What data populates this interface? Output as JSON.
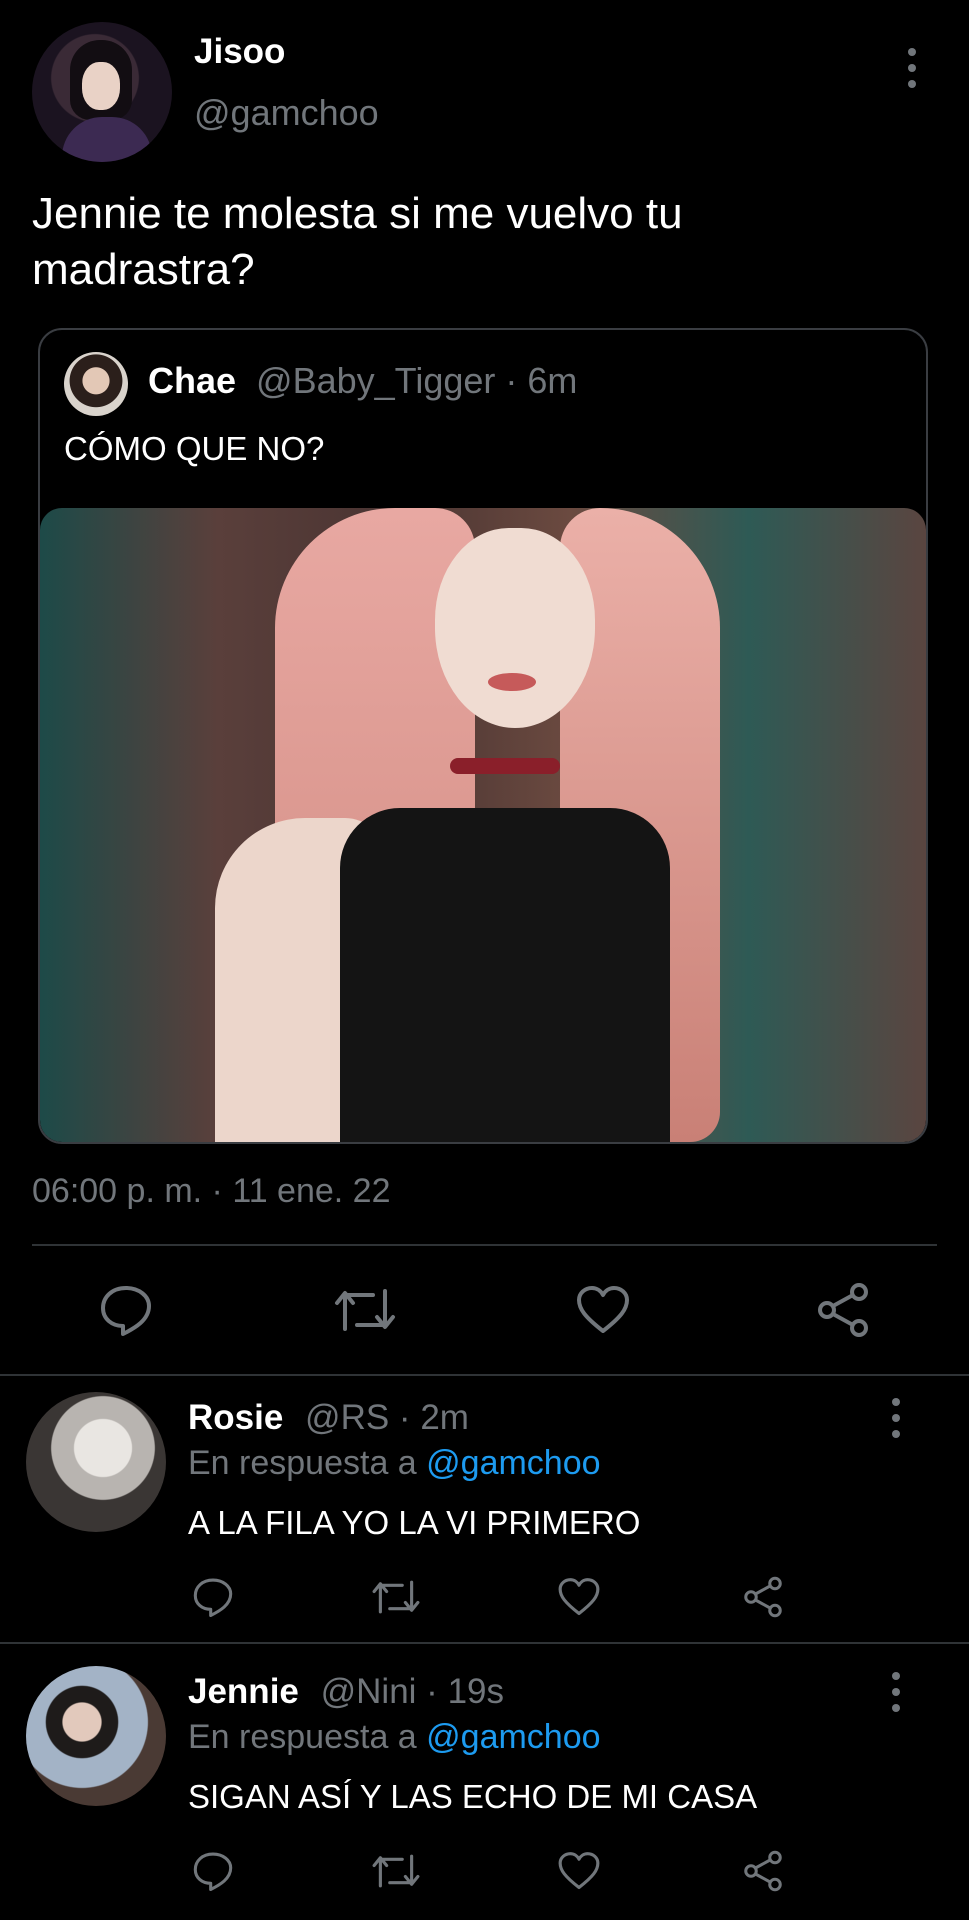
{
  "main_tweet": {
    "author_name": "Jisoo",
    "author_handle": "@gamchoo",
    "text": "Jennie te molesta si me vuelvo tu madrastra?",
    "timestamp": "06:00 p. m. · 11 ene. 22",
    "quoted": {
      "name": "Chae",
      "handle": "@Baby_Tigger",
      "separator": " · ",
      "time": "6m",
      "text": "CÓMO QUE NO?"
    },
    "actions": [
      "reply-icon",
      "retweet-icon",
      "like-icon",
      "share-icon"
    ]
  },
  "replies": [
    {
      "name": "Rosie",
      "handle": "@RS",
      "separator": " · ",
      "time": "2m",
      "in_reply_prefix": "En respuesta a ",
      "in_reply_mention": "@gamchoo",
      "text": "A LA FILA YO LA VI PRIMERO"
    },
    {
      "name": "Jennie",
      "handle": "@Nini",
      "separator": " · ",
      "time": "19s",
      "in_reply_prefix": "En respuesta a ",
      "in_reply_mention": "@gamchoo",
      "text": "SIGAN ASÍ Y LAS ECHO DE MI CASA"
    }
  ],
  "colors": {
    "background": "#000000",
    "text_primary": "#ffffff",
    "text_secondary": "#71767b",
    "link": "#1d9bf0",
    "divider": "#2f3336"
  }
}
